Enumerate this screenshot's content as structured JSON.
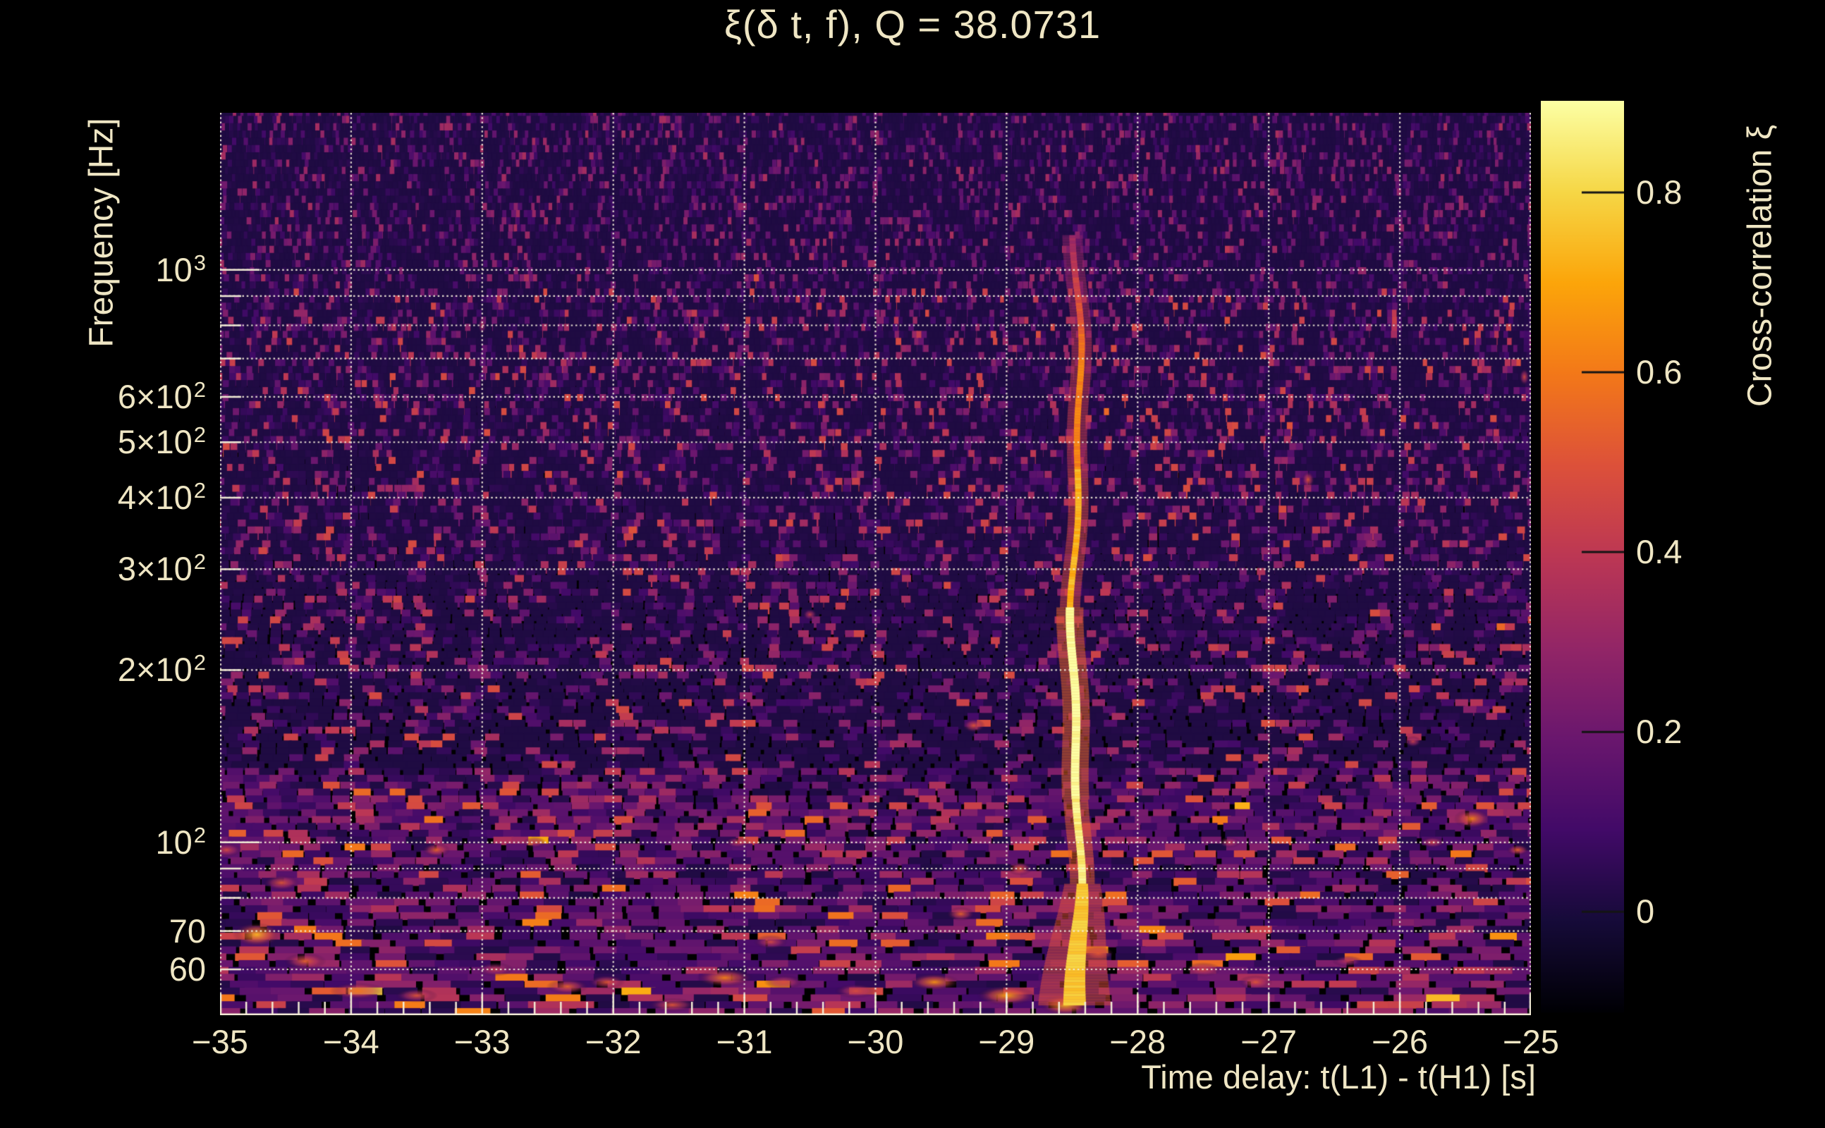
{
  "title": "ξ(δ t, f), Q = 38.0731",
  "colors": {
    "background": "#000000",
    "text": "#efe6c4",
    "gridline": "#f5efdb",
    "axis_line": "#f3ecd6",
    "colorbar_tick": "#141414"
  },
  "chart_data": {
    "type": "heatmap",
    "title": "ξ(δ t, f), Q = 38.0731",
    "q_value": 38.0731,
    "xlabel": "Time delay: t(L1) - t(H1) [s]",
    "ylabel": "Frequency [Hz]",
    "x_range": [
      -35,
      -25
    ],
    "x_tick_values": [
      -35,
      -34,
      -33,
      -32,
      -31,
      -30,
      -29,
      -28,
      -27,
      -26,
      -25
    ],
    "x_tick_labels": [
      "−35",
      "−34",
      "−33",
      "−32",
      "−31",
      "−30",
      "−29",
      "−28",
      "−27",
      "−26",
      "−25"
    ],
    "x_minor_tick_step": 0.2,
    "y_scale": "log",
    "y_range_hz": [
      49.9,
      1881
    ],
    "y_ticks": [
      {
        "hz": 1000,
        "mantissa": "10",
        "sup": "3",
        "major": true
      },
      {
        "hz": 600,
        "mantissa": "6×10",
        "sup": "2",
        "major": false
      },
      {
        "hz": 500,
        "mantissa": "5×10",
        "sup": "2",
        "major": false
      },
      {
        "hz": 400,
        "mantissa": "4×10",
        "sup": "2",
        "major": false
      },
      {
        "hz": 300,
        "mantissa": "3×10",
        "sup": "2",
        "major": false
      },
      {
        "hz": 200,
        "mantissa": "2×10",
        "sup": "2",
        "major": false
      },
      {
        "hz": 100,
        "mantissa": "10",
        "sup": "2",
        "major": true
      },
      {
        "hz": 70,
        "mantissa": "70",
        "sup": "",
        "major": false
      },
      {
        "hz": 60,
        "mantissa": "60",
        "sup": "",
        "major": false
      }
    ],
    "y_gridlines_hz": [
      60,
      70,
      80,
      90,
      100,
      200,
      300,
      400,
      500,
      600,
      700,
      800,
      900,
      1000
    ],
    "grid": true,
    "colorbar": {
      "title": "Cross-correlation ξ",
      "tick_labels": [
        "0.8",
        "0.6",
        "0.4",
        "0.2",
        "0"
      ],
      "tick_values": [
        0.8,
        0.6,
        0.4,
        0.2,
        0
      ],
      "value_range": [
        -0.112,
        0.902
      ]
    },
    "colormap": "inferno",
    "colormap_stops": [
      [
        0.0,
        0,
        0,
        4
      ],
      [
        0.1,
        22,
        11,
        57
      ],
      [
        0.2,
        66,
        10,
        104
      ],
      [
        0.3,
        106,
        23,
        110
      ],
      [
        0.4,
        147,
        38,
        103
      ],
      [
        0.5,
        188,
        55,
        84
      ],
      [
        0.6,
        221,
        81,
        58
      ],
      [
        0.7,
        243,
        120,
        25
      ],
      [
        0.8,
        252,
        165,
        10
      ],
      [
        0.9,
        246,
        215,
        70
      ],
      [
        1.0,
        252,
        255,
        164
      ]
    ],
    "noise": {
      "seed": 20731,
      "description": "dark purple stochastic cross-correlation noise; thin vertical needles at high frequency, broad horizontal smears at low frequency, brighter activity below ~130 Hz and near 100 Hz"
    },
    "features": {
      "chirp": {
        "time_delay": -28.47,
        "f_lo_hz": 52,
        "f_hi_hz": 1150,
        "peak_xi": 0.9,
        "description": "bright narrow vertical chirp track at δt ≈ −28.5 s, brightest (white-yellow) between ~90 and ~260 Hz, fading above ~700 Hz"
      },
      "hot_spot_columns": [
        "time_delay_s",
        "freq_hz",
        "rx_px",
        "ry_px",
        "xi"
      ],
      "hot_spots": [
        [
          -34.72,
          69,
          34,
          17,
          0.85
        ],
        [
          -34.95,
          97,
          22,
          10,
          0.5
        ],
        [
          -34.53,
          85,
          26,
          11,
          0.55
        ],
        [
          -34.35,
          62,
          30,
          12,
          0.6
        ],
        [
          -33.95,
          55,
          40,
          12,
          0.65
        ],
        [
          -33.5,
          54,
          30,
          10,
          0.55
        ],
        [
          -33.35,
          97,
          20,
          10,
          0.6
        ],
        [
          -32.9,
          60,
          26,
          10,
          0.45
        ],
        [
          -32.35,
          56,
          30,
          11,
          0.6
        ],
        [
          -32.05,
          57,
          26,
          10,
          0.55
        ],
        [
          -31.55,
          52,
          34,
          10,
          0.55
        ],
        [
          -31.15,
          58,
          40,
          13,
          0.7
        ],
        [
          -30.8,
          67,
          24,
          10,
          0.5
        ],
        [
          -31.05,
          100,
          18,
          8,
          0.45
        ],
        [
          -30.7,
          57,
          28,
          10,
          0.5
        ],
        [
          -30.15,
          55,
          30,
          10,
          0.5
        ],
        [
          -29.55,
          57,
          36,
          12,
          0.75
        ],
        [
          -29.0,
          54,
          42,
          14,
          0.8
        ],
        [
          -28.55,
          52,
          36,
          15,
          0.85
        ],
        [
          -28.3,
          64,
          22,
          10,
          0.6
        ],
        [
          -29.35,
          75,
          20,
          10,
          0.6
        ],
        [
          -29.25,
          160,
          16,
          10,
          0.55
        ],
        [
          -28.9,
          90,
          18,
          10,
          0.6
        ],
        [
          -27.5,
          60,
          26,
          10,
          0.5
        ],
        [
          -27.1,
          57,
          24,
          10,
          0.55
        ],
        [
          -26.4,
          62,
          22,
          8,
          0.4
        ],
        [
          -25.45,
          110,
          26,
          14,
          0.7
        ],
        [
          -25.75,
          100,
          18,
          8,
          0.5
        ],
        [
          -25.1,
          97,
          16,
          8,
          0.6
        ],
        [
          -26.7,
          430,
          9,
          12,
          0.55
        ],
        [
          -25.05,
          650,
          7,
          12,
          0.5
        ],
        [
          -33.0,
          800,
          6,
          12,
          0.4
        ],
        [
          -30.5,
          250,
          10,
          8,
          0.45
        ],
        [
          -25.9,
          150,
          12,
          8,
          0.45
        ],
        [
          -27.3,
          100,
          16,
          8,
          0.45
        ],
        [
          -32.6,
          100,
          16,
          8,
          0.45
        ]
      ]
    }
  }
}
